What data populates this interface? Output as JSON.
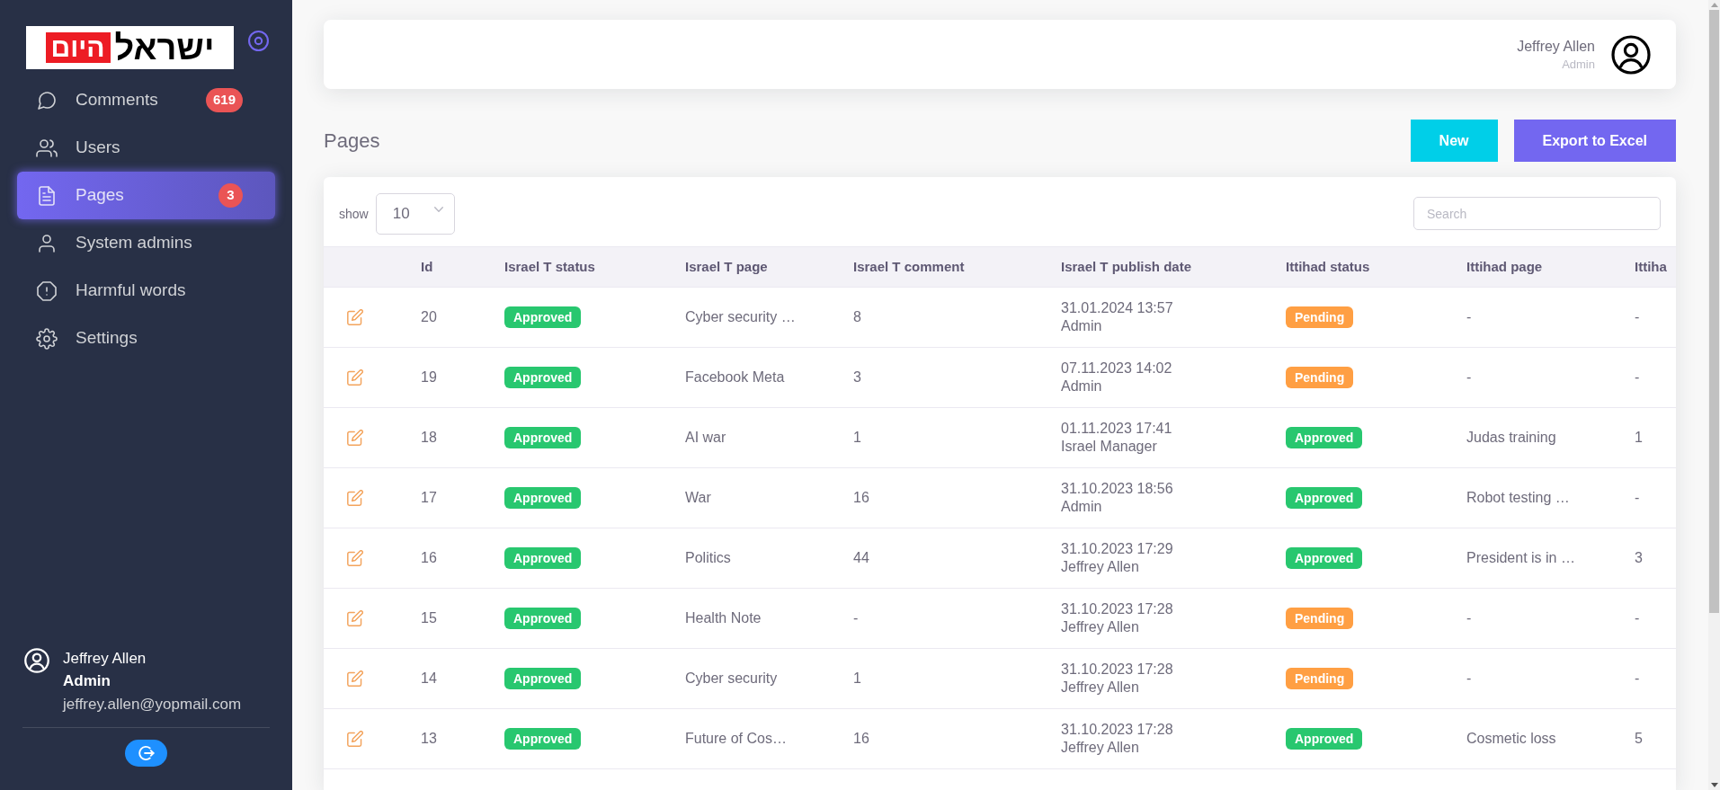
{
  "sidebar": {
    "logo": {
      "text": "ישראל",
      "highlight": "היום"
    },
    "items": [
      {
        "label": "Comments",
        "badge": "619",
        "selected": false
      },
      {
        "label": "Users",
        "selected": false
      },
      {
        "label": "Pages",
        "badge": "3",
        "selected": true
      },
      {
        "label": "System admins",
        "selected": false
      },
      {
        "label": "Harmful words",
        "selected": false
      },
      {
        "label": "Settings",
        "selected": false
      }
    ],
    "user": {
      "name": "Jeffrey Allen",
      "role": "Admin",
      "email": "jeffrey.allen@yopmail.com"
    }
  },
  "header": {
    "user": {
      "name": "Jeffrey Allen",
      "role": "Admin"
    }
  },
  "page": {
    "title": "Pages",
    "buttons": [
      {
        "label": "New",
        "kind": "info"
      },
      {
        "label": "Export to Excel",
        "kind": "primary"
      }
    ]
  },
  "table": {
    "show_label": "show",
    "page_size": "10",
    "search": {
      "placeholder": "Search"
    },
    "columns": [
      "Id",
      "Israel T status",
      "Israel T page",
      "Israel T comment",
      "Israel T publish date",
      "Ittihad status",
      "Ittihad page",
      "Ittiha"
    ],
    "rows": [
      {
        "id": "20",
        "israel_t_status": {
          "label": "Approved",
          "color": "#28c76f"
        },
        "israel_t_page": "Cyber security …",
        "israel_t_comment": "8",
        "israel_t_publish_date": "31.01.2024 13:57",
        "israel_t_publisher": "Admin",
        "ittihad_status": {
          "label": "Pending",
          "color": "#ff9f43"
        },
        "ittihad_page": "-",
        "column_9": "-"
      },
      {
        "id": "19",
        "israel_t_status": {
          "label": "Approved",
          "color": "#28c76f"
        },
        "israel_t_page": "Facebook Meta",
        "israel_t_comment": "3",
        "israel_t_publish_date": "07.11.2023 14:02",
        "israel_t_publisher": "Admin",
        "ittihad_status": {
          "label": "Pending",
          "color": "#ff9f43"
        },
        "ittihad_page": "-",
        "column_9": "-"
      },
      {
        "id": "18",
        "israel_t_status": {
          "label": "Approved",
          "color": "#28c76f"
        },
        "israel_t_page": "AI war",
        "israel_t_comment": "1",
        "israel_t_publish_date": "01.11.2023 17:41",
        "israel_t_publisher": "Israel Manager",
        "ittihad_status": {
          "label": "Approved",
          "color": "#28c76f"
        },
        "ittihad_page": "Judas training",
        "column_9": "1"
      },
      {
        "id": "17",
        "israel_t_status": {
          "label": "Approved",
          "color": "#28c76f"
        },
        "israel_t_page": "War",
        "israel_t_comment": "16",
        "israel_t_publish_date": "31.10.2023 18:56",
        "israel_t_publisher": "Admin",
        "ittihad_status": {
          "label": "Approved",
          "color": "#28c76f"
        },
        "ittihad_page": "Robot testing …",
        "column_9": "-"
      },
      {
        "id": "16",
        "israel_t_status": {
          "label": "Approved",
          "color": "#28c76f"
        },
        "israel_t_page": "Politics",
        "israel_t_comment": "44",
        "israel_t_publish_date": "31.10.2023 17:29",
        "israel_t_publisher": "Jeffrey Allen",
        "ittihad_status": {
          "label": "Approved",
          "color": "#28c76f"
        },
        "ittihad_page": "President is in …",
        "column_9": "3"
      },
      {
        "id": "15",
        "israel_t_status": {
          "label": "Approved",
          "color": "#28c76f"
        },
        "israel_t_page": "Health Note",
        "israel_t_comment": "-",
        "israel_t_publish_date": "31.10.2023 17:28",
        "israel_t_publisher": "Jeffrey Allen",
        "ittihad_status": {
          "label": "Pending",
          "color": "#ff9f43"
        },
        "ittihad_page": "-",
        "column_9": "-"
      },
      {
        "id": "14",
        "israel_t_status": {
          "label": "Approved",
          "color": "#28c76f"
        },
        "israel_t_page": "Cyber security",
        "israel_t_comment": "1",
        "israel_t_publish_date": "31.10.2023 17:28",
        "israel_t_publisher": "Jeffrey Allen",
        "ittihad_status": {
          "label": "Pending",
          "color": "#ff9f43"
        },
        "ittihad_page": "-",
        "column_9": "-"
      },
      {
        "id": "13",
        "israel_t_status": {
          "label": "Approved",
          "color": "#28c76f"
        },
        "israel_t_page": "Future of Cos…",
        "israel_t_comment": "16",
        "israel_t_publish_date": "31.10.2023 17:28",
        "israel_t_publisher": "Jeffrey Allen",
        "ittihad_status": {
          "label": "Approved",
          "color": "#28c76f"
        },
        "ittihad_page": "Cosmetic loss",
        "column_9": "5"
      }
    ]
  }
}
